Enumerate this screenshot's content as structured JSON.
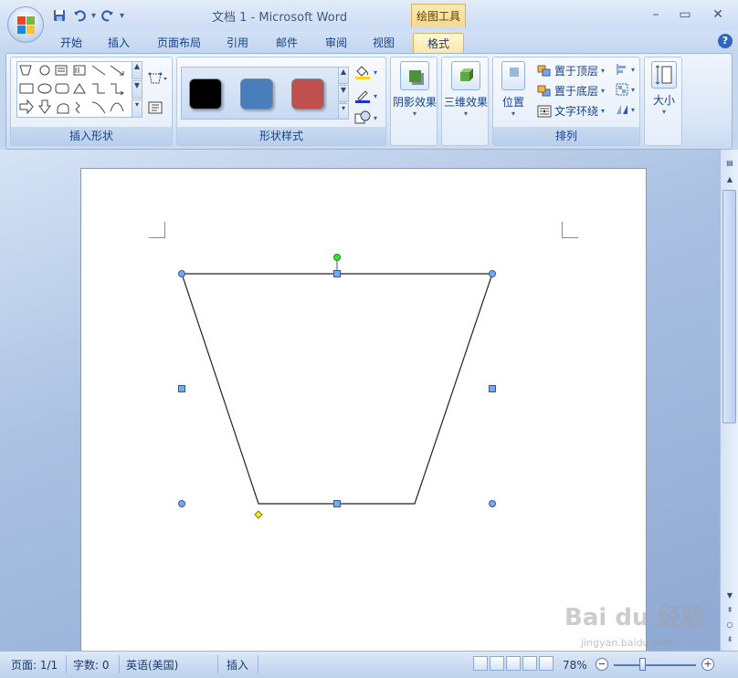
{
  "window": {
    "title": "文档 1 - Microsoft Word",
    "context_tab_header": "绘图工具",
    "controls": {
      "minimize": "–",
      "maximize": "▭",
      "close": "✕"
    }
  },
  "quick_access": {
    "save_icon": "save-icon",
    "undo_icon": "undo-icon",
    "redo_icon": "redo-icon",
    "customize": "▾"
  },
  "tabs": [
    {
      "label": "开始",
      "active": false
    },
    {
      "label": "插入",
      "active": false
    },
    {
      "label": "页面布局",
      "active": false
    },
    {
      "label": "引用",
      "active": false
    },
    {
      "label": "邮件",
      "active": false
    },
    {
      "label": "审阅",
      "active": false
    },
    {
      "label": "视图",
      "active": false
    },
    {
      "label": "格式",
      "active": true
    }
  ],
  "help": "?",
  "ribbon": {
    "insert_shapes": {
      "label": "插入形状"
    },
    "shape_styles": {
      "label": "形状样式",
      "swatches": [
        "#000000",
        "#4a7ebb",
        "#c0504d"
      ],
      "fill_color": "#ffd21c",
      "line_color": "#1c2fd6"
    },
    "shadow": {
      "label": "阴影效果"
    },
    "three_d": {
      "label": "三维效果"
    },
    "arrange": {
      "label": "排列",
      "position": "位置",
      "bring_front": "置于顶层",
      "send_back": "置于底层",
      "text_wrap": "文字环绕"
    },
    "size": {
      "label": "大小"
    }
  },
  "status": {
    "page": "页面: 1/1",
    "words": "字数: 0",
    "language": "英语(美国)",
    "mode": "插入",
    "zoom": "78%"
  },
  "watermark": {
    "text": "Bai du 经验",
    "sub": "jingyan.baidu.com"
  }
}
